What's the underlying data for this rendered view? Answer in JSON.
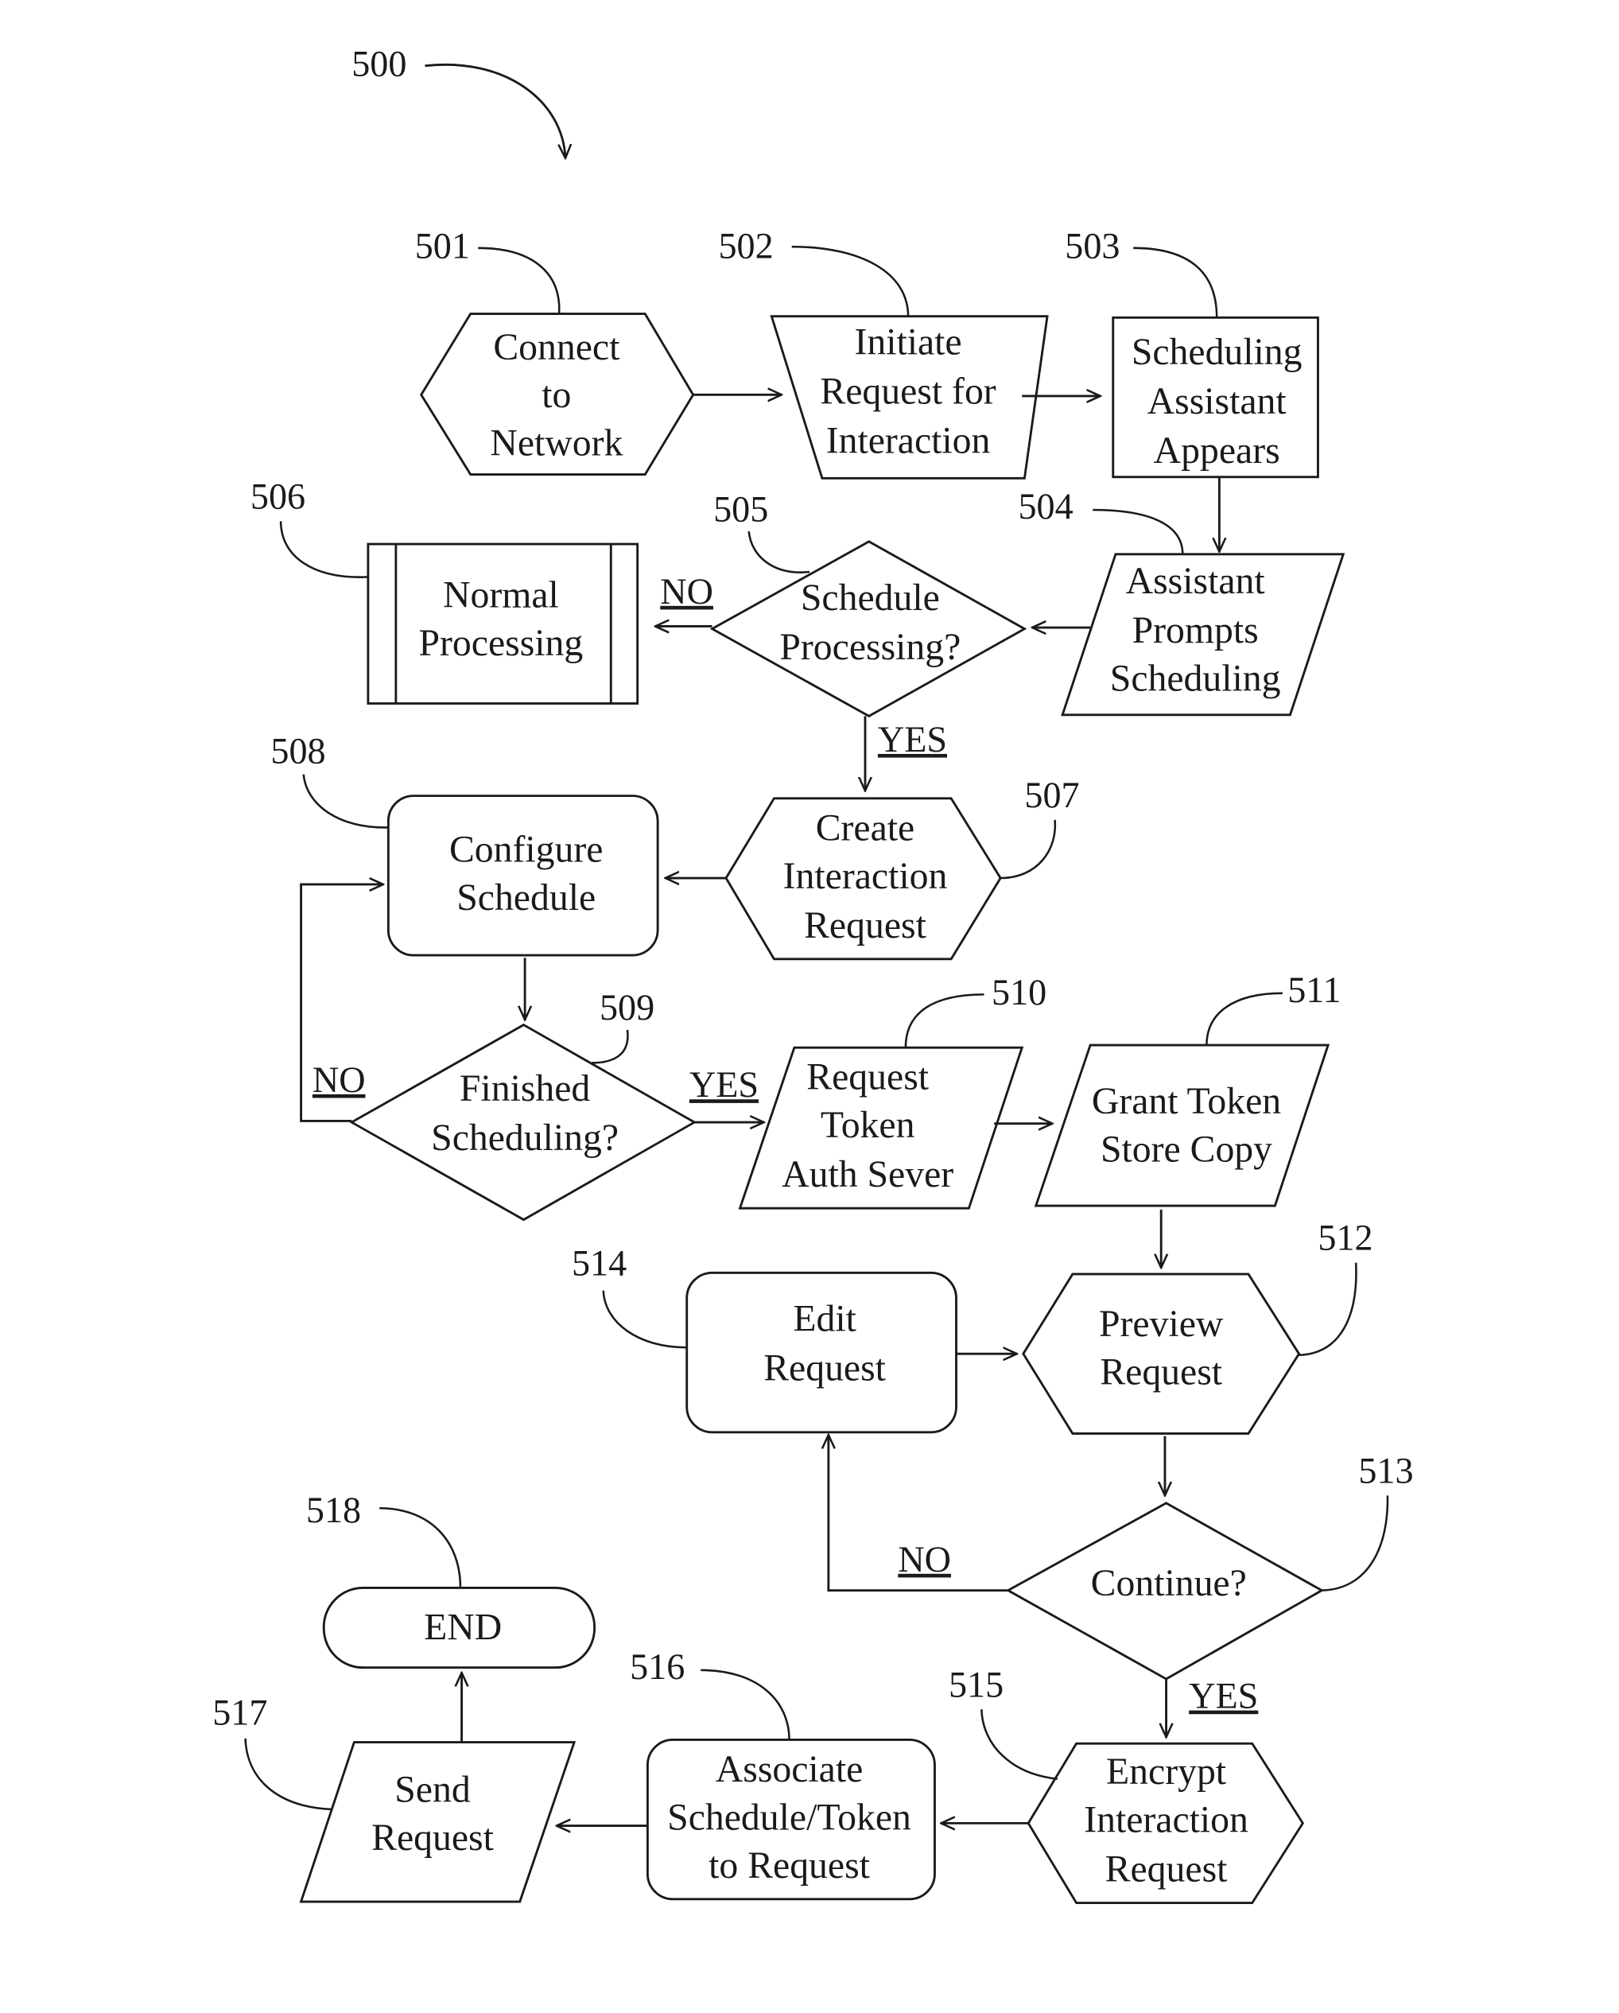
{
  "figure": {
    "ref": "500",
    "nodes": {
      "n501": {
        "ref": "501",
        "shape": "hexagon",
        "lines": [
          "Connect",
          "to",
          "Network"
        ]
      },
      "n502": {
        "ref": "502",
        "shape": "trapezoid",
        "lines": [
          "Initiate",
          "Request for",
          "Interaction"
        ]
      },
      "n503": {
        "ref": "503",
        "shape": "rectangle",
        "lines": [
          "Scheduling",
          "Assistant",
          "Appears"
        ]
      },
      "n504": {
        "ref": "504",
        "shape": "parallelogram",
        "lines": [
          "Assistant",
          "Prompts",
          "Scheduling"
        ]
      },
      "n505": {
        "ref": "505",
        "shape": "diamond",
        "lines": [
          "Schedule",
          "Processing?"
        ]
      },
      "n506": {
        "ref": "506",
        "shape": "predefined-process",
        "lines": [
          "Normal",
          "Processing"
        ]
      },
      "n507": {
        "ref": "507",
        "shape": "hexagon",
        "lines": [
          "Create",
          "Interaction",
          "Request"
        ]
      },
      "n508": {
        "ref": "508",
        "shape": "rounded-rectangle",
        "lines": [
          "Configure",
          "Schedule"
        ]
      },
      "n509": {
        "ref": "509",
        "shape": "diamond",
        "lines": [
          "Finished",
          "Scheduling?"
        ]
      },
      "n510": {
        "ref": "510",
        "shape": "parallelogram",
        "lines": [
          "Request",
          "Token",
          "Auth Sever"
        ]
      },
      "n511": {
        "ref": "511",
        "shape": "parallelogram",
        "lines": [
          "Grant Token",
          "Store Copy"
        ]
      },
      "n512": {
        "ref": "512",
        "shape": "hexagon",
        "lines": [
          "Preview",
          "Request"
        ]
      },
      "n513": {
        "ref": "513",
        "shape": "diamond",
        "lines": [
          "Continue?"
        ]
      },
      "n514": {
        "ref": "514",
        "shape": "rounded-rectangle",
        "lines": [
          "Edit",
          "Request"
        ]
      },
      "n515": {
        "ref": "515",
        "shape": "hexagon",
        "lines": [
          "Encrypt",
          "Interaction",
          "Request"
        ]
      },
      "n516": {
        "ref": "516",
        "shape": "rounded-rectangle",
        "lines": [
          "Associate",
          "Schedule/Token",
          "to Request"
        ]
      },
      "n517": {
        "ref": "517",
        "shape": "parallelogram",
        "lines": [
          "Send",
          "Request"
        ]
      },
      "n518": {
        "ref": "518",
        "shape": "terminator",
        "lines": [
          "END"
        ]
      }
    },
    "edge_labels": {
      "e505_no": "NO",
      "e505_yes": "YES",
      "e509_no": "NO",
      "e509_yes": "YES",
      "e513_no": "NO",
      "e513_yes": "YES"
    }
  }
}
